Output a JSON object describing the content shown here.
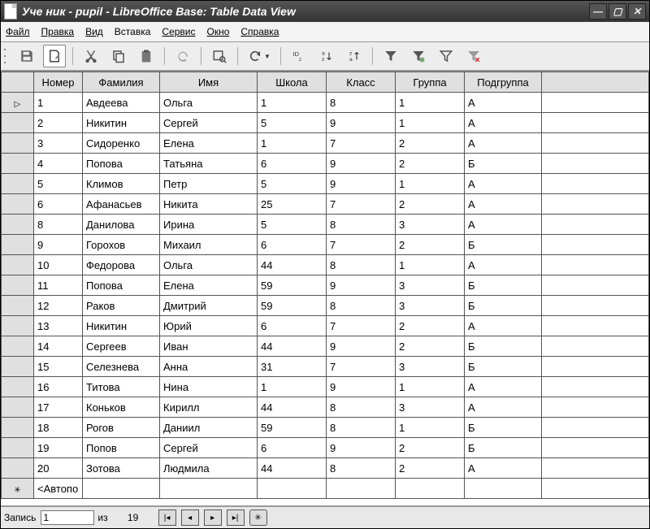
{
  "window": {
    "title": "Уче ник  - pupil - LibreOffice Base: Table Data View"
  },
  "menu": {
    "file": "Файл",
    "edit": "Правка",
    "view": "Вид",
    "insert": "Вставка",
    "tools": "Сервис",
    "window": "Окно",
    "help": "Справка"
  },
  "table": {
    "headers": {
      "num": "Номер",
      "fam": "Фамилия",
      "name": "Имя",
      "school": "Школа",
      "class": "Класс",
      "group": "Группа",
      "subgroup": "Подгруппа"
    },
    "rows": [
      {
        "num": "1",
        "fam": "Авдеева",
        "name": "Ольга",
        "school": "1",
        "class": "8",
        "group": "1",
        "sub": "А"
      },
      {
        "num": "2",
        "fam": "Никитин",
        "name": "Сергей",
        "school": "5",
        "class": "9",
        "group": "1",
        "sub": "А"
      },
      {
        "num": "3",
        "fam": "Сидоренко",
        "name": "Елена",
        "school": "1",
        "class": "7",
        "group": "2",
        "sub": "А"
      },
      {
        "num": "4",
        "fam": "Попова",
        "name": "Татьяна",
        "school": "6",
        "class": "9",
        "group": "2",
        "sub": "Б"
      },
      {
        "num": "5",
        "fam": "Климов",
        "name": "Петр",
        "school": "5",
        "class": "9",
        "group": "1",
        "sub": "А"
      },
      {
        "num": "6",
        "fam": "Афанасьев",
        "name": "Никита",
        "school": "25",
        "class": "7",
        "group": "2",
        "sub": "А"
      },
      {
        "num": "8",
        "fam": "Данилова",
        "name": "Ирина",
        "school": "5",
        "class": "8",
        "group": "3",
        "sub": "А"
      },
      {
        "num": "9",
        "fam": "Горохов",
        "name": "Михаил",
        "school": "6",
        "class": "7",
        "group": "2",
        "sub": "Б"
      },
      {
        "num": "10",
        "fam": "Федорова",
        "name": "Ольга",
        "school": "44",
        "class": "8",
        "group": "1",
        "sub": "А"
      },
      {
        "num": "11",
        "fam": "Попова",
        "name": "Елена",
        "school": "59",
        "class": "9",
        "group": "3",
        "sub": "Б"
      },
      {
        "num": "12",
        "fam": "Раков",
        "name": "Дмитрий",
        "school": "59",
        "class": "8",
        "group": "3",
        "sub": "Б"
      },
      {
        "num": "13",
        "fam": "Никитин",
        "name": "Юрий",
        "school": "6",
        "class": "7",
        "group": "2",
        "sub": "А"
      },
      {
        "num": "14",
        "fam": "Сергеев",
        "name": "Иван",
        "school": "44",
        "class": "9",
        "group": "2",
        "sub": "Б"
      },
      {
        "num": "15",
        "fam": "Селезнева",
        "name": "Анна",
        "school": "31",
        "class": "7",
        "group": "3",
        "sub": "Б"
      },
      {
        "num": "16",
        "fam": "Титова",
        "name": "Нина",
        "school": "1",
        "class": "9",
        "group": "1",
        "sub": "А"
      },
      {
        "num": "17",
        "fam": "Коньков",
        "name": "Кирилл",
        "school": "44",
        "class": "8",
        "group": "3",
        "sub": "А"
      },
      {
        "num": "18",
        "fam": "Рогов",
        "name": "Даниил",
        "school": "59",
        "class": "8",
        "group": "1",
        "sub": "Б"
      },
      {
        "num": "19",
        "fam": "Попов",
        "name": "Сергей",
        "school": "6",
        "class": "9",
        "group": "2",
        "sub": "Б"
      },
      {
        "num": "20",
        "fam": "Зотова",
        "name": "Людмила",
        "school": "44",
        "class": "8",
        "group": "2",
        "sub": "А"
      }
    ],
    "new_row_label": "<Автопо"
  },
  "nav": {
    "record_label": "Запись",
    "current": "1",
    "of_label": "из",
    "total": "19"
  }
}
